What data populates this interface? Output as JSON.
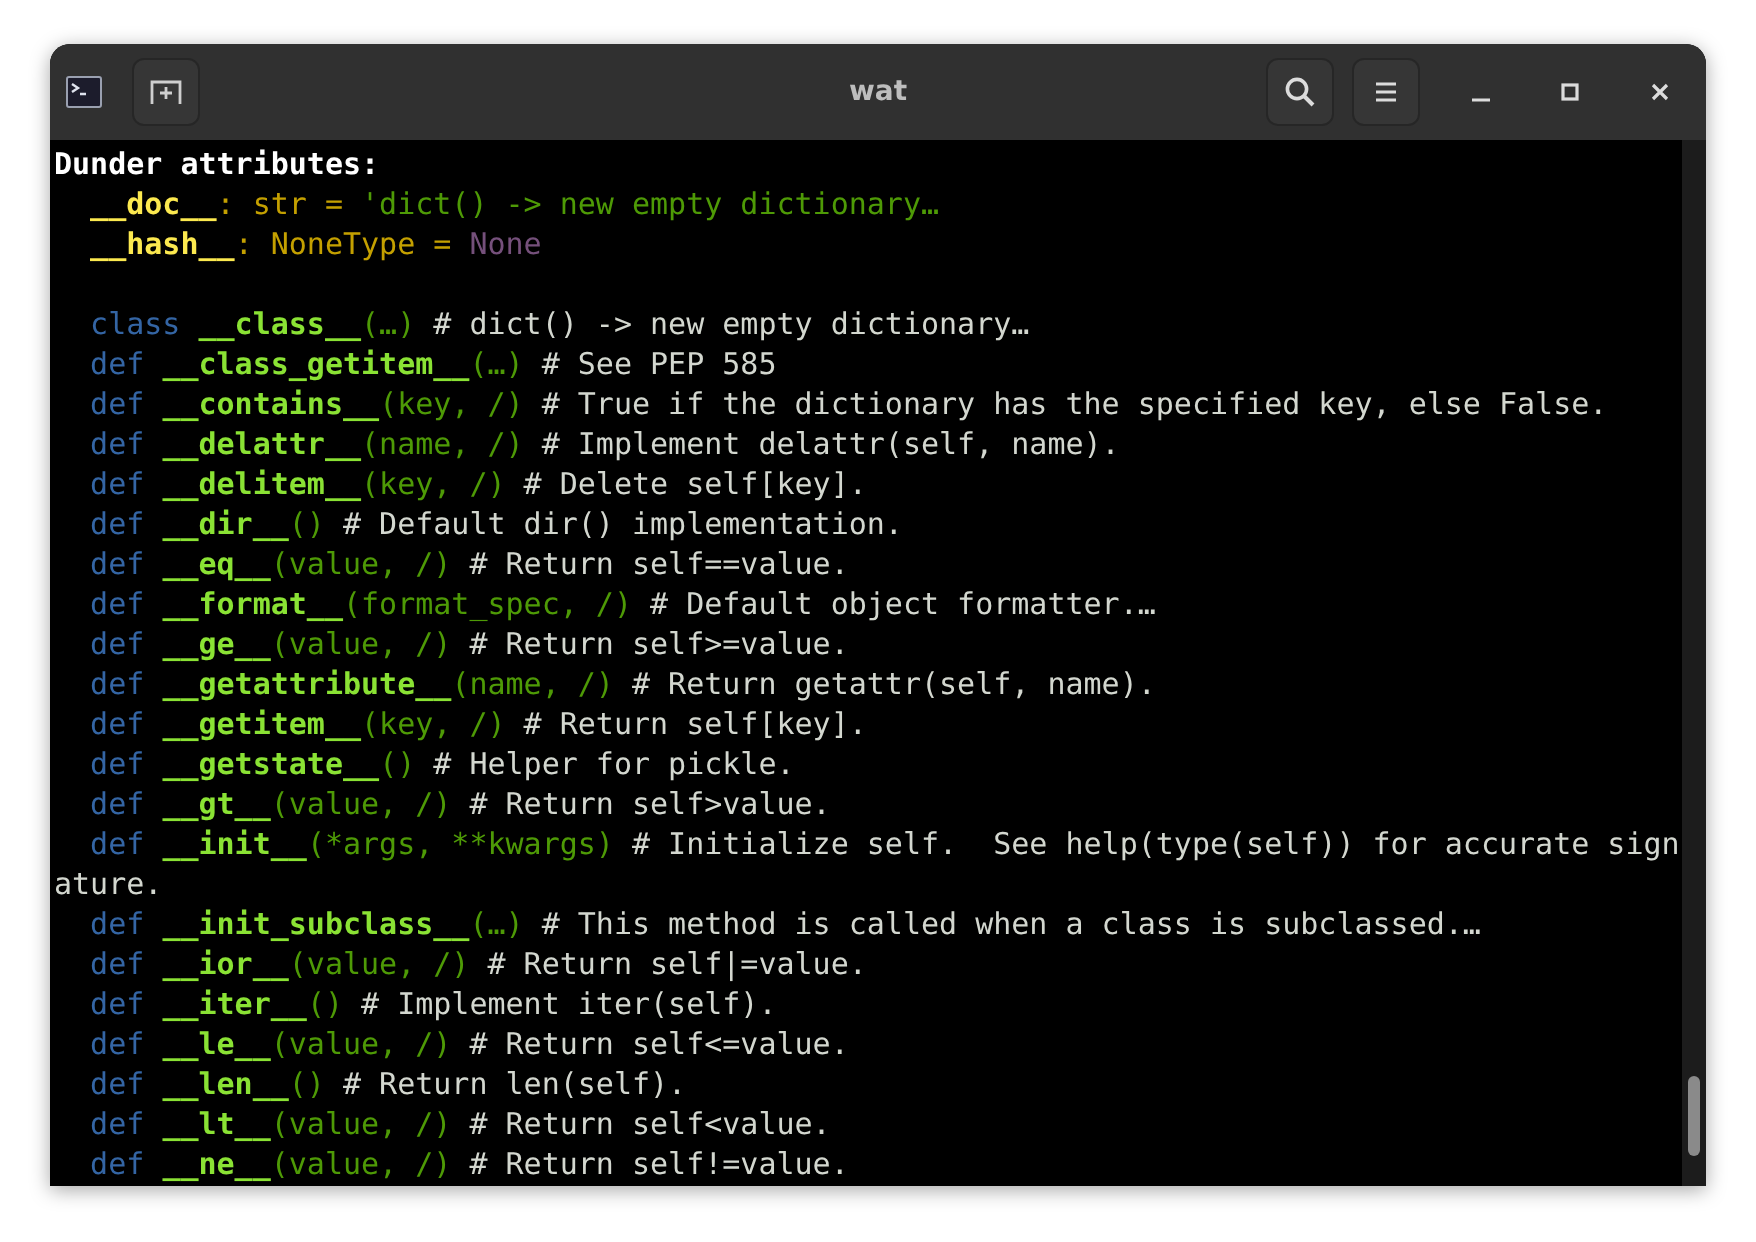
{
  "window": {
    "title": "wat"
  },
  "terminal": {
    "lines": [
      {
        "kind": "code",
        "segments": [
          {
            "kind": "heading",
            "text": "Dunder attributes:"
          }
        ]
      },
      {
        "kind": "code",
        "segments": [
          {
            "kind": "attr",
            "text": "  __doc__"
          },
          {
            "kind": "type",
            "text": ": str = "
          },
          {
            "kind": "string",
            "text": "'dict() -> new empty dictionary…"
          }
        ]
      },
      {
        "kind": "code",
        "segments": [
          {
            "kind": "attr",
            "text": "  __hash__"
          },
          {
            "kind": "type",
            "text": ": NoneType = "
          },
          {
            "kind": "none",
            "text": "None"
          }
        ]
      },
      {
        "kind": "blank"
      },
      {
        "kind": "code",
        "segments": [
          {
            "kind": "keyword",
            "text": "  class "
          },
          {
            "kind": "name",
            "text": "__class__"
          },
          {
            "kind": "args",
            "text": "(…)"
          },
          {
            "kind": "comment",
            "text": " # dict() -> new empty dictionary…"
          }
        ]
      },
      {
        "kind": "code",
        "segments": [
          {
            "kind": "keyword",
            "text": "  def "
          },
          {
            "kind": "name",
            "text": "__class_getitem__"
          },
          {
            "kind": "args",
            "text": "(…)"
          },
          {
            "kind": "comment",
            "text": " # See PEP 585"
          }
        ]
      },
      {
        "kind": "code",
        "segments": [
          {
            "kind": "keyword",
            "text": "  def "
          },
          {
            "kind": "name",
            "text": "__contains__"
          },
          {
            "kind": "args",
            "text": "(key, /)"
          },
          {
            "kind": "comment",
            "text": " # True if the dictionary has the specified key, else False."
          }
        ]
      },
      {
        "kind": "code",
        "segments": [
          {
            "kind": "keyword",
            "text": "  def "
          },
          {
            "kind": "name",
            "text": "__delattr__"
          },
          {
            "kind": "args",
            "text": "(name, /)"
          },
          {
            "kind": "comment",
            "text": " # Implement delattr(self, name)."
          }
        ]
      },
      {
        "kind": "code",
        "segments": [
          {
            "kind": "keyword",
            "text": "  def "
          },
          {
            "kind": "name",
            "text": "__delitem__"
          },
          {
            "kind": "args",
            "text": "(key, /)"
          },
          {
            "kind": "comment",
            "text": " # Delete self[key]."
          }
        ]
      },
      {
        "kind": "code",
        "segments": [
          {
            "kind": "keyword",
            "text": "  def "
          },
          {
            "kind": "name",
            "text": "__dir__"
          },
          {
            "kind": "args",
            "text": "()"
          },
          {
            "kind": "comment",
            "text": " # Default dir() implementation."
          }
        ]
      },
      {
        "kind": "code",
        "segments": [
          {
            "kind": "keyword",
            "text": "  def "
          },
          {
            "kind": "name",
            "text": "__eq__"
          },
          {
            "kind": "args",
            "text": "(value, /)"
          },
          {
            "kind": "comment",
            "text": " # Return self==value."
          }
        ]
      },
      {
        "kind": "code",
        "segments": [
          {
            "kind": "keyword",
            "text": "  def "
          },
          {
            "kind": "name",
            "text": "__format__"
          },
          {
            "kind": "args",
            "text": "(format_spec, /)"
          },
          {
            "kind": "comment",
            "text": " # Default object formatter.…"
          }
        ]
      },
      {
        "kind": "code",
        "segments": [
          {
            "kind": "keyword",
            "text": "  def "
          },
          {
            "kind": "name",
            "text": "__ge__"
          },
          {
            "kind": "args",
            "text": "(value, /)"
          },
          {
            "kind": "comment",
            "text": " # Return self>=value."
          }
        ]
      },
      {
        "kind": "code",
        "segments": [
          {
            "kind": "keyword",
            "text": "  def "
          },
          {
            "kind": "name",
            "text": "__getattribute__"
          },
          {
            "kind": "args",
            "text": "(name, /)"
          },
          {
            "kind": "comment",
            "text": " # Return getattr(self, name)."
          }
        ]
      },
      {
        "kind": "code",
        "segments": [
          {
            "kind": "keyword",
            "text": "  def "
          },
          {
            "kind": "name",
            "text": "__getitem__"
          },
          {
            "kind": "args",
            "text": "(key, /)"
          },
          {
            "kind": "comment",
            "text": " # Return self[key]."
          }
        ]
      },
      {
        "kind": "code",
        "segments": [
          {
            "kind": "keyword",
            "text": "  def "
          },
          {
            "kind": "name",
            "text": "__getstate__"
          },
          {
            "kind": "args",
            "text": "()"
          },
          {
            "kind": "comment",
            "text": " # Helper for pickle."
          }
        ]
      },
      {
        "kind": "code",
        "segments": [
          {
            "kind": "keyword",
            "text": "  def "
          },
          {
            "kind": "name",
            "text": "__gt__"
          },
          {
            "kind": "args",
            "text": "(value, /)"
          },
          {
            "kind": "comment",
            "text": " # Return self>value."
          }
        ]
      },
      {
        "kind": "code",
        "segments": [
          {
            "kind": "keyword",
            "text": "  def "
          },
          {
            "kind": "name",
            "text": "__init__"
          },
          {
            "kind": "args",
            "text": "(*args, **kwargs)"
          },
          {
            "kind": "comment",
            "text": " # Initialize self.  See help(type(self)) for accurate sign"
          }
        ]
      },
      {
        "kind": "code",
        "segments": [
          {
            "kind": "comment",
            "text": "ature."
          }
        ]
      },
      {
        "kind": "code",
        "segments": [
          {
            "kind": "keyword",
            "text": "  def "
          },
          {
            "kind": "name",
            "text": "__init_subclass__"
          },
          {
            "kind": "args",
            "text": "(…)"
          },
          {
            "kind": "comment",
            "text": " # This method is called when a class is subclassed.…"
          }
        ]
      },
      {
        "kind": "code",
        "segments": [
          {
            "kind": "keyword",
            "text": "  def "
          },
          {
            "kind": "name",
            "text": "__ior__"
          },
          {
            "kind": "args",
            "text": "(value, /)"
          },
          {
            "kind": "comment",
            "text": " # Return self|=value."
          }
        ]
      },
      {
        "kind": "code",
        "segments": [
          {
            "kind": "keyword",
            "text": "  def "
          },
          {
            "kind": "name",
            "text": "__iter__"
          },
          {
            "kind": "args",
            "text": "()"
          },
          {
            "kind": "comment",
            "text": " # Implement iter(self)."
          }
        ]
      },
      {
        "kind": "code",
        "segments": [
          {
            "kind": "keyword",
            "text": "  def "
          },
          {
            "kind": "name",
            "text": "__le__"
          },
          {
            "kind": "args",
            "text": "(value, /)"
          },
          {
            "kind": "comment",
            "text": " # Return self<=value."
          }
        ]
      },
      {
        "kind": "code",
        "segments": [
          {
            "kind": "keyword",
            "text": "  def "
          },
          {
            "kind": "name",
            "text": "__len__"
          },
          {
            "kind": "args",
            "text": "()"
          },
          {
            "kind": "comment",
            "text": " # Return len(self)."
          }
        ]
      },
      {
        "kind": "code",
        "segments": [
          {
            "kind": "keyword",
            "text": "  def "
          },
          {
            "kind": "name",
            "text": "__lt__"
          },
          {
            "kind": "args",
            "text": "(value, /)"
          },
          {
            "kind": "comment",
            "text": " # Return self<value."
          }
        ]
      },
      {
        "kind": "code",
        "segments": [
          {
            "kind": "keyword",
            "text": "  def "
          },
          {
            "kind": "name",
            "text": "__ne__"
          },
          {
            "kind": "args",
            "text": "(value, /)"
          },
          {
            "kind": "comment",
            "text": " # Return self!=value."
          }
        ]
      }
    ]
  }
}
